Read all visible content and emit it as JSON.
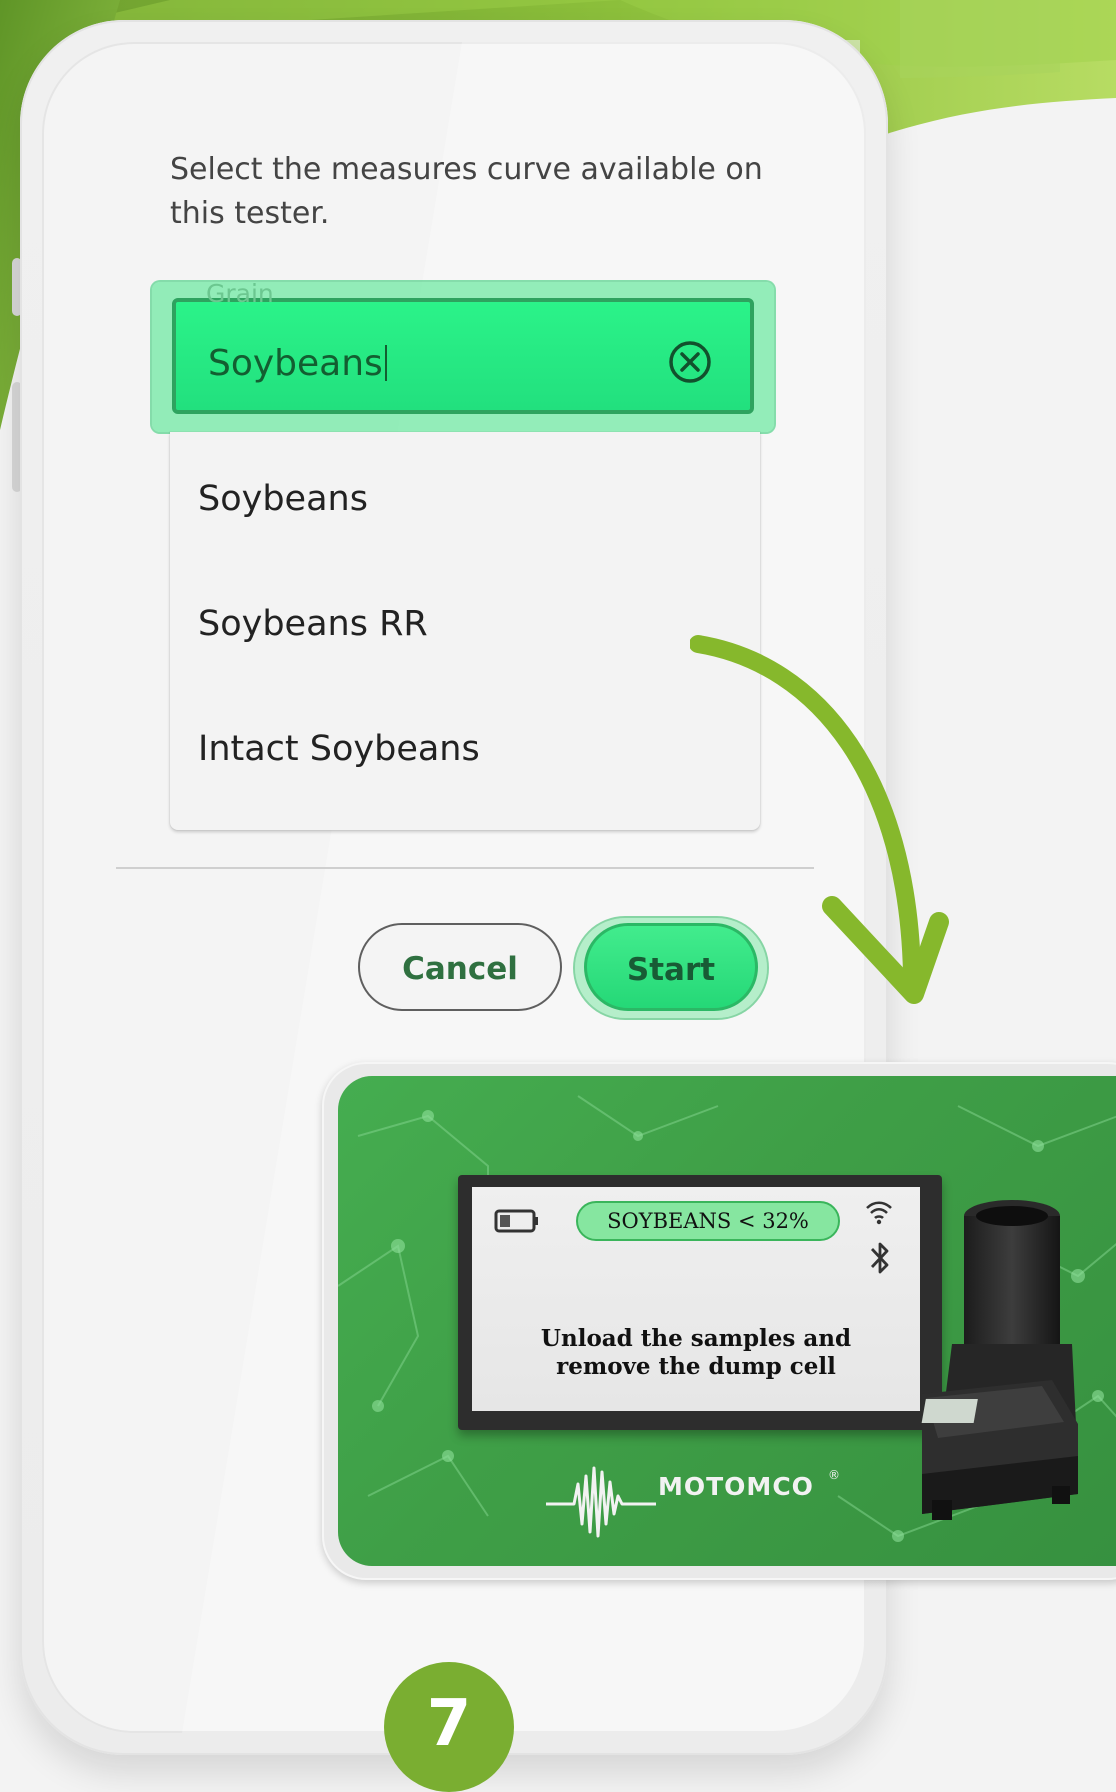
{
  "dialog": {
    "instruction": "Select the measures curve available on this tester.",
    "field": {
      "label": "Grain",
      "value": "Soybeans",
      "icon": "clear-circle-x-icon"
    },
    "options": [
      {
        "label": "Soybeans"
      },
      {
        "label": "Soybeans RR"
      },
      {
        "label": "Intact Soybeans"
      }
    ],
    "buttons": {
      "cancel": "Cancel",
      "start": "Start"
    }
  },
  "device_preview": {
    "screen_title": "SOYBEANS < 32%",
    "screen_message": "Unload the samples and remove the dump cell",
    "brand": "MOTOMCO",
    "brand_mark": "®",
    "icons": [
      "battery-icon",
      "wifi-icon",
      "bluetooth-icon"
    ]
  },
  "step": {
    "number": "7"
  },
  "colors": {
    "accent_green": "#2BF389",
    "brand_green": "#7AAE31",
    "device_bg": "#45AD50"
  }
}
